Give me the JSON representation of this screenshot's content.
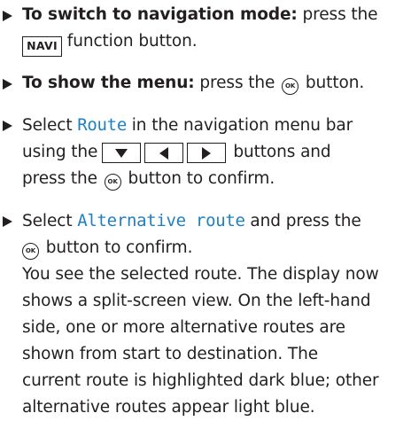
{
  "steps": [
    {
      "bold": "To switch to navigation mode:",
      "text_a": " press the",
      "key": "NAVI",
      "text_b": " function button."
    },
    {
      "bold": "To show the menu:",
      "text_a": " press the ",
      "ok": "OK",
      "text_b": " button."
    },
    {
      "text_a": "Select ",
      "term": "Route",
      "text_b": " in the navigation menu bar",
      "text_c": "using the",
      "text_d": "buttons and",
      "text_e": "press the ",
      "ok": "OK",
      "text_f": " button to confirm."
    },
    {
      "text_a": "Select ",
      "term": "Alternative route",
      "text_b": " and press the",
      "ok": "OK",
      "text_c": " button to confirm.",
      "para": [
        "You see the selected route. The display now",
        "shows a split-screen view. On the left-hand",
        "side, one or more alternative routes are",
        "shown from start to destination. The",
        "current route is highlighted dark blue; other",
        "alternative routes appear light blue."
      ]
    }
  ],
  "icons": {
    "bullet": "triangle-right-bullet",
    "key_down": "arrow-down-key",
    "key_left": "arrow-left-key",
    "key_right": "arrow-right-key",
    "ok_button": "ok-button-icon"
  },
  "colors": {
    "text": "#231f20",
    "ui_term": "#1f7fc4"
  }
}
